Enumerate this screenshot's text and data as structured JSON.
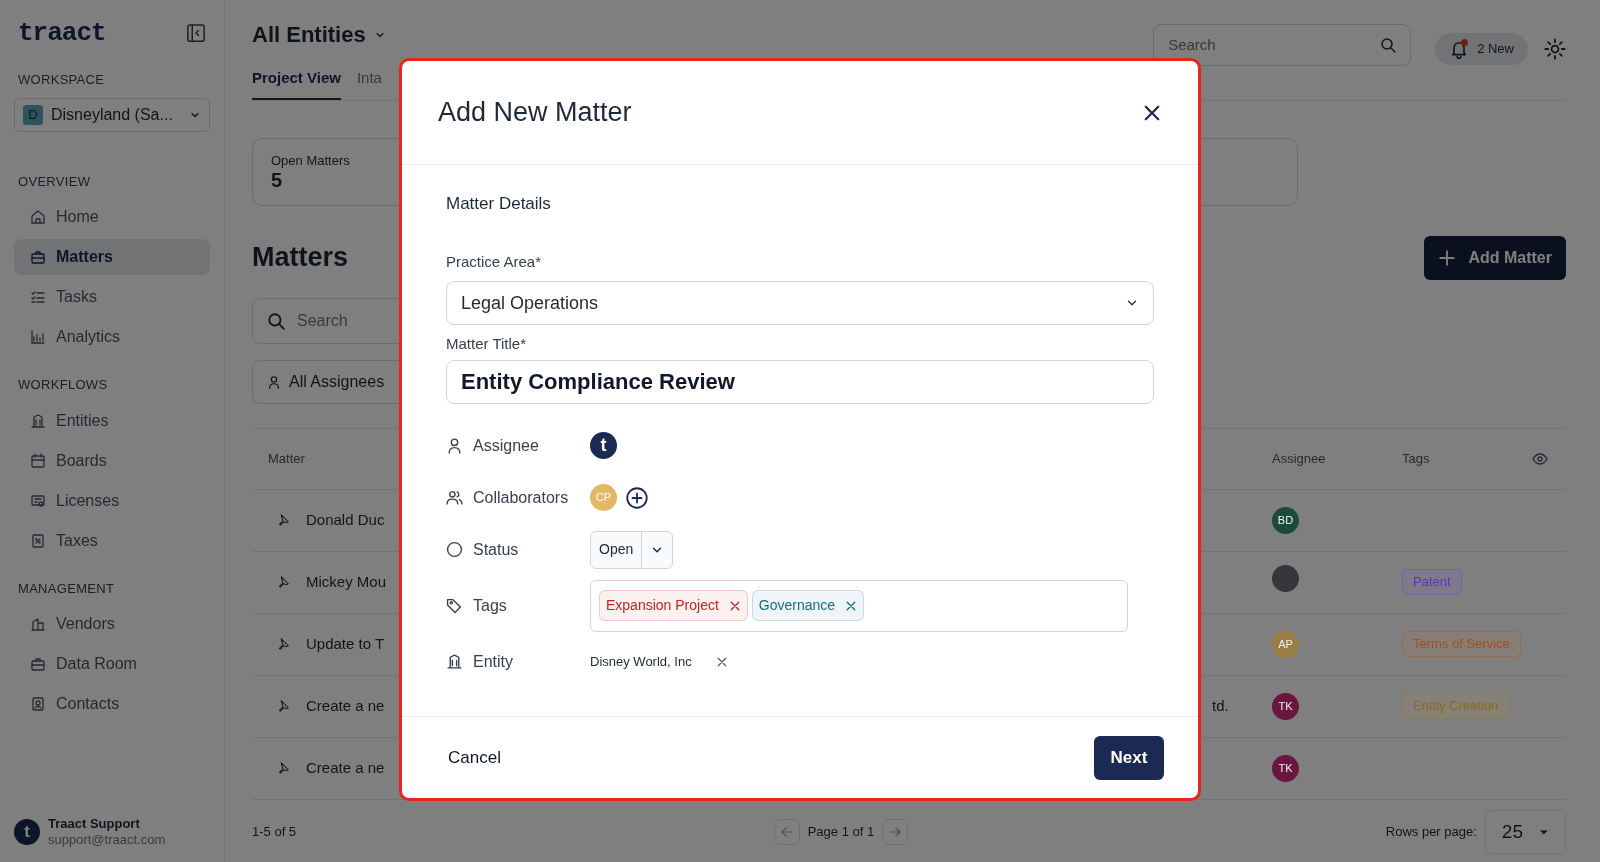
{
  "sidebar": {
    "logo": "traact",
    "workspace_label": "WORKSPACE",
    "workspace": {
      "initial": "D",
      "name": "Disneyland (Sa..."
    },
    "sections": [
      {
        "heading": "OVERVIEW",
        "items": [
          {
            "label": "Home",
            "selected": false
          },
          {
            "label": "Matters",
            "selected": true
          },
          {
            "label": "Tasks",
            "selected": false
          },
          {
            "label": "Analytics",
            "selected": false
          }
        ]
      },
      {
        "heading": "WORKFLOWS",
        "items": [
          {
            "label": "Entities",
            "selected": false
          },
          {
            "label": "Boards",
            "selected": false
          },
          {
            "label": "Licenses",
            "selected": false
          },
          {
            "label": "Taxes",
            "selected": false
          }
        ]
      },
      {
        "heading": "MANAGEMENT",
        "items": [
          {
            "label": "Vendors",
            "selected": false
          },
          {
            "label": "Data Room",
            "selected": false
          },
          {
            "label": "Contacts",
            "selected": false
          }
        ]
      }
    ],
    "user": {
      "avatar": "t",
      "name": "Traact Support",
      "email": "support@traact.com"
    }
  },
  "header": {
    "title": "All Entities",
    "tabs": [
      {
        "label": "Project View",
        "selected": true
      },
      {
        "label": "Inta",
        "selected": false
      }
    ],
    "search": {
      "placeholder": "Search"
    },
    "notifications": "2 New"
  },
  "stats": [
    {
      "label": "Open Matters",
      "value": "5"
    }
  ],
  "matters": {
    "title": "Matters",
    "add_button": "Add Matter",
    "search": {
      "placeholder": "Search"
    },
    "assignee_filter": "All Assignees",
    "columns": [
      "Matter",
      "Assignee",
      "Tags"
    ],
    "rows": [
      {
        "matter": "Donald Duc",
        "assignee": {
          "kind": "initials",
          "text": "BD",
          "color": "#1c4a3c"
        }
      },
      {
        "matter": "Mickey Mou",
        "assignee": {
          "kind": "photo"
        },
        "tag": {
          "label": "Patent",
          "color": "#5b35b5"
        }
      },
      {
        "matter": "Update to T",
        "assignee": {
          "kind": "initials",
          "text": "AP",
          "color": "#9a7d45"
        },
        "tag": {
          "label": "Terms of Service",
          "color": "#a0501a"
        }
      },
      {
        "matter": "Create a ne",
        "column_2": "td.",
        "assignee": {
          "kind": "initials",
          "text": "TK",
          "color": "#6a1640"
        },
        "tag": {
          "label": "Entity Creation",
          "color": "#8c6a1f"
        }
      },
      {
        "matter": "Create a ne",
        "assignee": {
          "kind": "initials",
          "text": "TK",
          "color": "#6a1640"
        }
      }
    ]
  },
  "pagination": {
    "range": "1-5 of 5",
    "page": "Page 1 of 1",
    "rows_per_page_label": "Rows per page:",
    "rows_per_page": "25"
  },
  "modal": {
    "title": "Add New Matter",
    "section": "Matter Details",
    "practice_area": {
      "label": "Practice Area*",
      "value": "Legal Operations"
    },
    "matter_title": {
      "label": "Matter Title*",
      "value": "Entity Compliance Review"
    },
    "properties": [
      {
        "kind": "assignee",
        "label": "Assignee",
        "avatar": "t"
      },
      {
        "kind": "collaborators",
        "label": "Collaborators",
        "avatars": [
          {
            "initials": "CP",
            "color": "#e3b766"
          }
        ]
      },
      {
        "kind": "status",
        "label": "Status",
        "value": "Open"
      },
      {
        "kind": "tags",
        "label": "Tags",
        "tags": [
          {
            "label": "Expansion Project",
            "color": "#c0261d"
          },
          {
            "label": "Governance",
            "color": "#0f6f86"
          }
        ]
      },
      {
        "kind": "entity",
        "label": "Entity",
        "value": "Disney World, Inc"
      }
    ],
    "cancel": "Cancel",
    "next": "Next"
  }
}
